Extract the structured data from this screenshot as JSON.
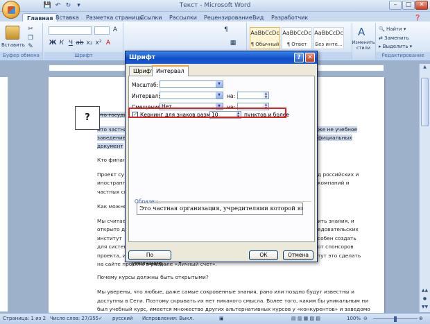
{
  "window": {
    "title": "Текст - Microsoft Word"
  },
  "quick_access": {
    "icons": [
      "save-icon",
      "undo-icon",
      "redo-icon",
      "customize-icon"
    ]
  },
  "tabs": [
    "Главная",
    "Вставка",
    "Разметка страницы",
    "Ссылки",
    "Рассылки",
    "Рецензирование",
    "Вид",
    "Разработчик"
  ],
  "ribbon": {
    "paste_label": "Вставить",
    "groups": {
      "clipboard": "Буфер обмена",
      "font": "Шрифт",
      "editing": "Редактирование"
    },
    "styles": [
      {
        "sample": "AaBbCcDc",
        "name": "¶ Обычный"
      },
      {
        "sample": "AaBbCcDc",
        "name": "¶ Ответ"
      },
      {
        "sample": "AaBbCcDc",
        "name": "Без инте..."
      }
    ],
    "change_styles": "Изменить стили",
    "editing": {
      "find": "Найти",
      "replace": "Заменить",
      "select": "Выделить"
    }
  },
  "document": {
    "lines": [
      {
        "text": "Это государственно...",
        "hl": true
      },
      {
        "text": "Это частна",
        "hl": true,
        "tail": "же не учебное"
      },
      {
        "text": "заведение",
        "hl": true,
        "tail": "фициальных"
      },
      {
        "text": "документ",
        "hl": true
      },
      {
        "text": "Кто финан"
      },
      {
        "text": "Проект су",
        "tail": "д российских и"
      },
      {
        "text": "иностранн",
        "tail": "компаний и"
      },
      {
        "text": "частных сп"
      },
      {
        "text": "Как можно"
      },
      {
        "text": "Мы считае",
        "tail": "ить знания, и"
      },
      {
        "text": "открыто д",
        "tail": "едовательских"
      },
      {
        "text": "институт",
        "tail": "собен создать"
      },
      {
        "text": "для систем",
        "tail": "от спонсоров"
      },
      {
        "text": "проекта, и",
        "tail": "тут это сделать"
      },
      {
        "text": "на сайте проекта в разделе «Личный счет»."
      },
      {
        "text": "Почему курсы должны быть открытыми?"
      },
      {
        "text": "Мы уверены, что любые, даже самые сокровенные знания, рано или поздно будут известны и"
      },
      {
        "text": "доступны в Сети. Поэтому скрывать их нет никакого смысла. Более того, каким бы уникальным ни"
      },
      {
        "text": "был учебный курс, имеется множество других альтернативных курсов у «конкурентов» и заведомо"
      }
    ]
  },
  "status": {
    "page": "Страница: 1 из 2",
    "words": "Число слов: 27/355",
    "lang": "русский",
    "track": "Исправления: Выкл.",
    "zoom": "100%"
  },
  "callout": {
    "text": "?"
  },
  "dialog": {
    "title": "Шрифт",
    "tabs": [
      "Шрифт",
      "Интервал"
    ],
    "active_tab": "Интервал",
    "scale_label": "Масштаб:",
    "scale_value": "",
    "spacing_label": "Интервал:",
    "spacing_value": "",
    "spacing_by_label": "на:",
    "spacing_by_value": "",
    "position_label": "Смещение:",
    "position_value": "Нет",
    "position_by_label": "на:",
    "position_by_value": "",
    "kerning_label": "Кернинг для знаков размером:",
    "kerning_checked": true,
    "kerning_value": "10",
    "kerning_suffix": "пунктов и более",
    "sample_label": "Образец",
    "sample_text": "Это частная организация, учредителями которой являются ф",
    "buttons": {
      "default": "По умолчанию...",
      "ok": "ОК",
      "cancel": "Отмена"
    }
  }
}
